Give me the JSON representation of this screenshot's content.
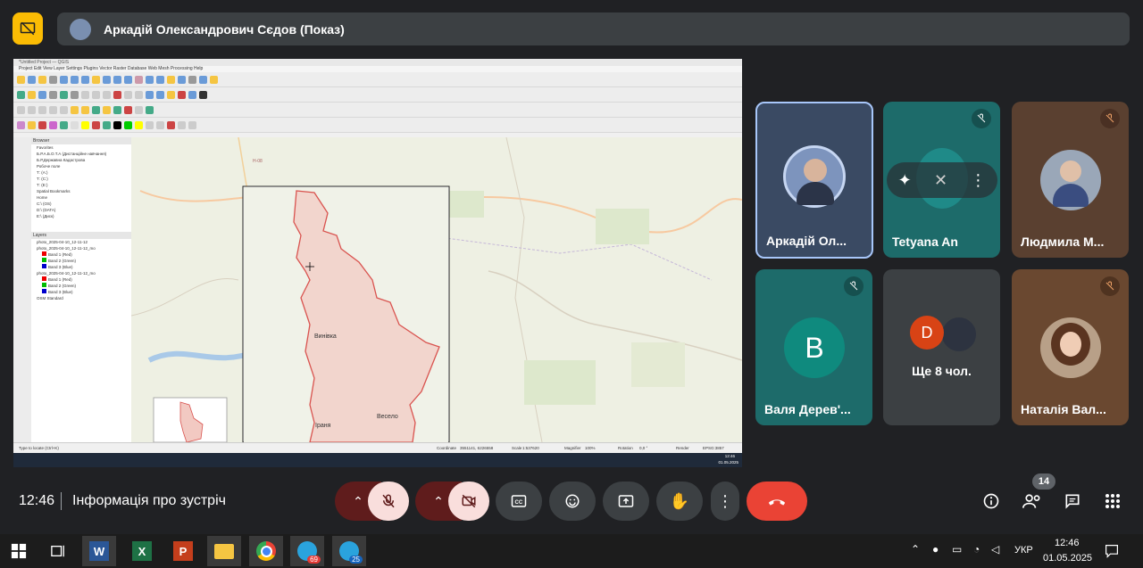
{
  "header": {
    "presenter_name": "Аркадій Олександрович Сєдов (Показ)"
  },
  "shared_screen": {
    "window_title": "*Untitled Project — QGIS",
    "menu": "Project  Edit  View  Layer  Settings  Plugins  Vector  Raster  Database  Web  Mesh  Processing  Help",
    "browser_title": "Browser",
    "browser_items": [
      "Favorites",
      "Б.Р.А.Б.О.Т.А (Дистанційне навчання)",
      "Б.Р.Державна Кадастрова",
      "Робоче поле",
      "Т: (A:)",
      "Т: (C:)",
      "Т: (E:)",
      "Spatial Bookmarks",
      "Home",
      "C:\\ (OS)",
      "D:\\ (DATA)",
      "E:\\ (Диск)"
    ],
    "layers_title": "Layers",
    "layers": [
      "photo_2025-04-10_12-11-12",
      "photo_2025-04-10_12-11-12_mo",
      "Band 1 (Red)",
      "Band 2 (Green)",
      "Band 3 (Blue)",
      "photo_2025-04-10_12-11-12_mo",
      "Band 1 (Red)",
      "Band 2 (Green)",
      "Band 3 (Blue)",
      "OSM Standard"
    ],
    "map_labels": {
      "place1": "Винівка",
      "place2": "Весело",
      "place3": "Іраня",
      "road": "Н-08"
    },
    "status": {
      "search": "Type to locate (Ctrl+K)",
      "coordinate_label": "Coordinate",
      "coordinate": "3551141, 6226558",
      "scale_label": "Scale",
      "scale": "1:537620",
      "magnifier_label": "Magnifier",
      "magnifier": "100%",
      "rotation_label": "Rotation",
      "rotation": "0,0 °",
      "render": "Render",
      "crs": "EPSG:3857",
      "time": "12:46",
      "date": "01.05.2025"
    }
  },
  "participants": [
    {
      "name": "Аркадій Ол...",
      "muted": false
    },
    {
      "name": "Tetyana An",
      "muted": true
    },
    {
      "name": "Людмила М...",
      "muted": true
    },
    {
      "name": "Валя Дерев'...",
      "initial": "В",
      "muted": true
    },
    {
      "name": "Ще 8 чол.",
      "initial": "D"
    },
    {
      "name": "Наталія Вал...",
      "muted": true
    }
  ],
  "bottom": {
    "time": "12:46",
    "meeting_info": "Інформація про зустріч",
    "people_count": "14"
  },
  "taskbar": {
    "telegram_badge_1": "69",
    "telegram_badge_2": "25",
    "lang": "УКР",
    "time": "12:46",
    "date": "01.05.2025"
  },
  "colors": {
    "present_yellow": "#fbbc04",
    "end_call_red": "#ea4335",
    "muted_ctrl_dark": "#5f1c1c",
    "muted_ctrl_light": "#f9dedc",
    "tile_teal": "#1d6b6a"
  }
}
